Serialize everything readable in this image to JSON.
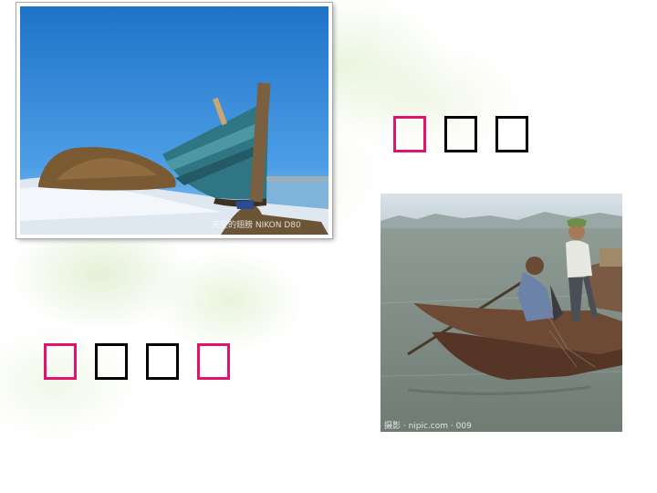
{
  "colors": {
    "highlight_box": "#e0146c",
    "plain_box": "#000000",
    "background": "#ffffff"
  },
  "photos": {
    "beached_boat": {
      "watermark": "天空的翅膀 NIKON D80"
    },
    "fishing_boat": {
      "watermark": "摄影 · nipic.com · 009"
    }
  },
  "box_rows": {
    "top": [
      "red",
      "black",
      "black"
    ],
    "bottom": [
      "red",
      "black",
      "black",
      "red"
    ]
  }
}
